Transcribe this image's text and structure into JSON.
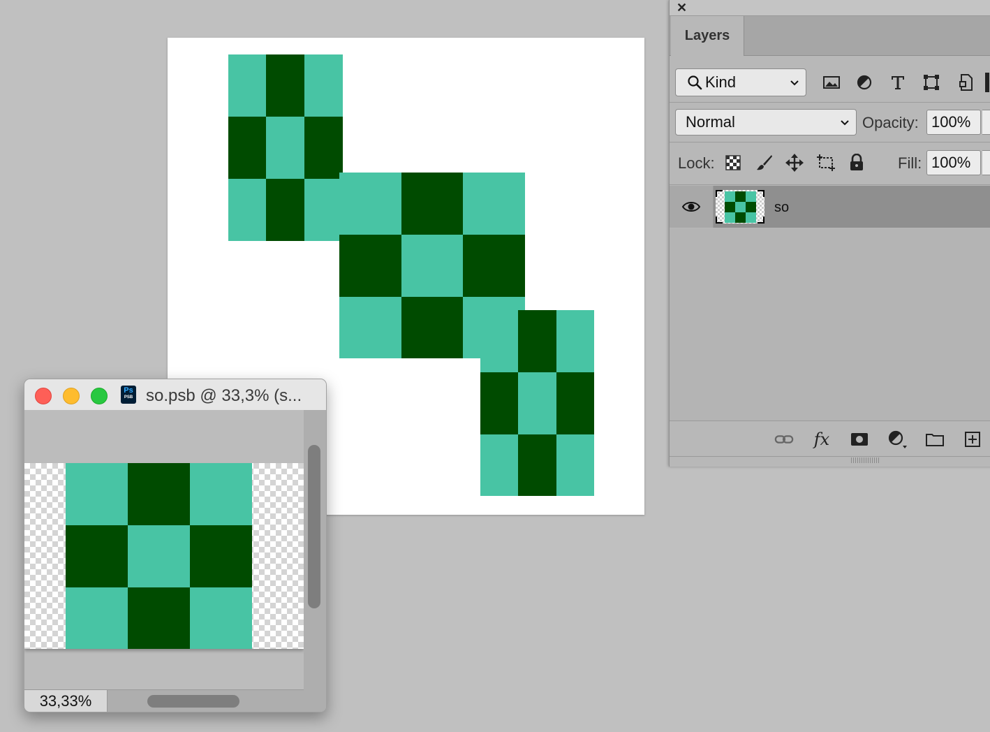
{
  "colors": {
    "light_green": "#48c4a4",
    "dark_green": "#004b00",
    "canvas": "#ffffff"
  },
  "checker_pattern": [
    1,
    0,
    1,
    0,
    1,
    0,
    1,
    0,
    1
  ],
  "layers_panel": {
    "close_glyph": "✕",
    "tab_label": "Layers",
    "filter": {
      "icon": "search-icon",
      "label": "Kind"
    },
    "filter_icons": [
      "image-filter-icon",
      "adjustment-filter-icon",
      "type-filter-icon",
      "shape-filter-icon",
      "smart-object-filter-icon"
    ],
    "blend_mode": "Normal",
    "opacity_label": "Opacity:",
    "opacity_value": "100%",
    "lock_label": "Lock:",
    "lock_icons": [
      "lock-transparent-pixels-icon",
      "lock-image-pixels-icon",
      "lock-position-icon",
      "lock-artboard-icon",
      "lock-all-icon"
    ],
    "fill_label": "Fill:",
    "fill_value": "100%",
    "layers": [
      {
        "name": "so",
        "visible": true,
        "selected": true,
        "type": "smart-object"
      }
    ],
    "bottom_icons": [
      "link-layers-icon",
      "fx-icon",
      "add-mask-icon",
      "new-adjustment-layer-icon",
      "new-group-icon",
      "new-layer-icon"
    ],
    "fx_text": "fx"
  },
  "doc_window": {
    "app_badge": "Ps",
    "app_badge_sub": "PSB",
    "title": "so.psb @ 33,3% (s...",
    "zoom": "33,33%"
  }
}
